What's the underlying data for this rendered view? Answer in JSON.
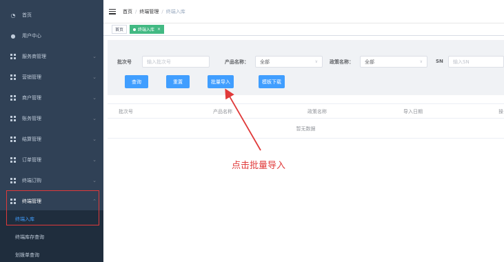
{
  "sidebar": {
    "items": [
      {
        "label": "首页",
        "icon": "dashboard-icon"
      },
      {
        "label": "用户中心",
        "icon": "user-icon"
      },
      {
        "label": "服务商管理",
        "icon": "grid-icon"
      },
      {
        "label": "营销管理",
        "icon": "grid-icon"
      },
      {
        "label": "商户管理",
        "icon": "grid-icon"
      },
      {
        "label": "账务管理",
        "icon": "grid-icon"
      },
      {
        "label": "结算管理",
        "icon": "grid-icon"
      },
      {
        "label": "订单管理",
        "icon": "grid-icon"
      },
      {
        "label": "终端订购",
        "icon": "grid-icon"
      },
      {
        "label": "终端管理",
        "icon": "grid-icon"
      }
    ],
    "submenu": [
      {
        "label": "终端入库"
      },
      {
        "label": "终端库存查询"
      },
      {
        "label": "划拨单查询"
      }
    ]
  },
  "breadcrumb": {
    "home": "首页",
    "parent": "终端管理",
    "current": "终端入库"
  },
  "tags": {
    "home": "首页",
    "active": "终端入库"
  },
  "filters": {
    "batch_label": "批次号",
    "batch_placeholder": "输入批次号",
    "product_label": "产品名称：",
    "product_value": "全部",
    "policy_label": "政策名称：",
    "policy_value": "全部",
    "sn_label": "SN",
    "sn_placeholder": "输入SN"
  },
  "buttons": {
    "query": "查询",
    "reset": "重置",
    "batch_import": "批量导入",
    "template_download": "模板下载"
  },
  "table": {
    "columns": [
      "批次号",
      "产品名称",
      "政策名称",
      "导入日期",
      "操"
    ],
    "empty_text": "暂无数据"
  },
  "annotation": {
    "text": "点击批量导入",
    "color": "#e03a3a"
  },
  "colors": {
    "sidebar": "#304156",
    "primary": "#409eff",
    "tag_active": "#42b983"
  }
}
